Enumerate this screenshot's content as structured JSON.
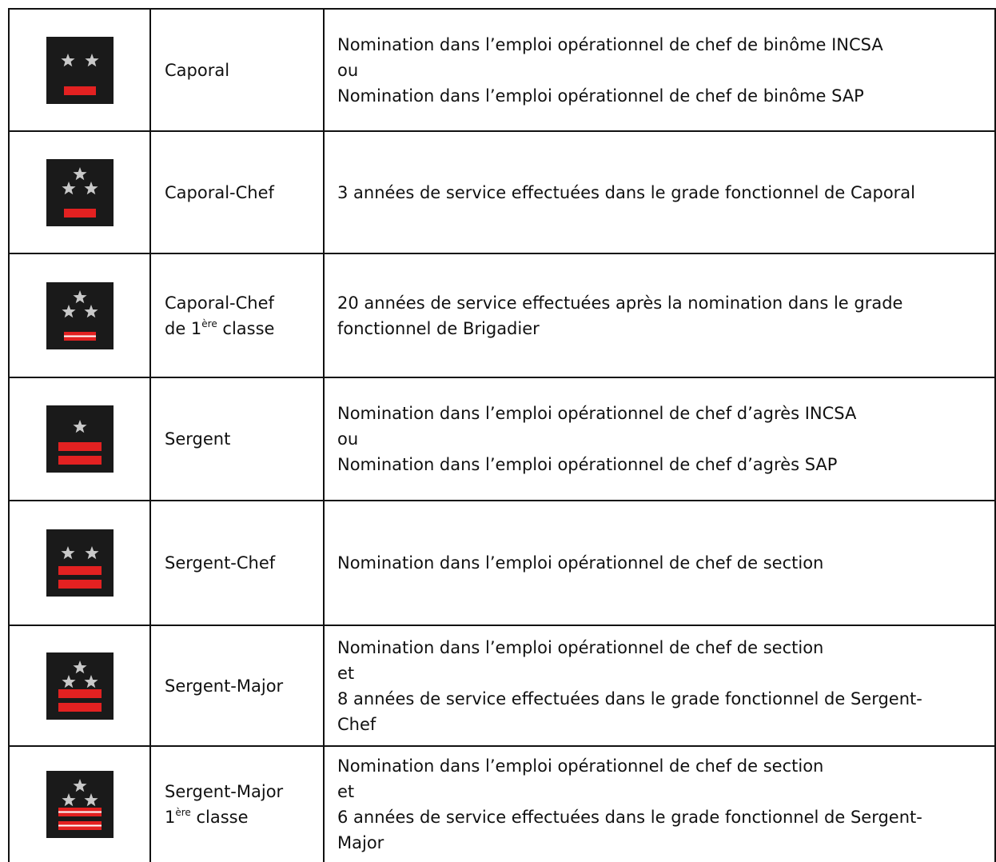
{
  "colors": {
    "insignia_bg": "#1a1a1a",
    "star": "#c9c9c9",
    "stripe": "#e32121",
    "stripe_line": "#ffffff",
    "border": "#111111"
  },
  "rows": [
    {
      "insignia": {
        "stars": 2,
        "stripes": 1,
        "white_line": false
      },
      "grade": {
        "line1": "Caporal",
        "line2_pre": "",
        "line2_sup": "",
        "line2_post": ""
      },
      "conditions": [
        "Nomination dans l’emploi opérationnel de chef de binôme INCSA",
        "ou",
        "Nomination dans l’emploi opérationnel de chef de binôme SAP"
      ]
    },
    {
      "insignia": {
        "stars": 3,
        "stripes": 1,
        "white_line": false
      },
      "grade": {
        "line1": "Caporal-Chef",
        "line2_pre": "",
        "line2_sup": "",
        "line2_post": ""
      },
      "conditions": [
        "3 années de service effectuées dans le grade fonctionnel de Caporal"
      ]
    },
    {
      "insignia": {
        "stars": 3,
        "stripes": 1,
        "white_line": true
      },
      "grade": {
        "line1": "Caporal-Chef",
        "line2_pre": "de 1",
        "line2_sup": "ère",
        "line2_post": " classe"
      },
      "conditions": [
        "20 années de service effectuées après la nomination dans le grade",
        "fonctionnel de Brigadier"
      ]
    },
    {
      "insignia": {
        "stars": 1,
        "stripes": 2,
        "white_line": false
      },
      "grade": {
        "line1": "Sergent",
        "line2_pre": "",
        "line2_sup": "",
        "line2_post": ""
      },
      "conditions": [
        "Nomination dans l’emploi opérationnel de chef d’agrès INCSA",
        "ou",
        "Nomination dans l’emploi opérationnel de chef d’agrès SAP"
      ]
    },
    {
      "insignia": {
        "stars": 2,
        "stripes": 2,
        "white_line": false
      },
      "grade": {
        "line1": "Sergent-Chef",
        "line2_pre": "",
        "line2_sup": "",
        "line2_post": ""
      },
      "conditions": [
        "Nomination dans l’emploi opérationnel de chef de section"
      ]
    },
    {
      "insignia": {
        "stars": 3,
        "stripes": 2,
        "white_line": false
      },
      "grade": {
        "line1": "Sergent-Major",
        "line2_pre": "",
        "line2_sup": "",
        "line2_post": ""
      },
      "conditions": [
        "Nomination dans l’emploi opérationnel de chef de section",
        "et",
        "8 années de service effectuées dans le grade fonctionnel de Sergent-",
        "Chef"
      ]
    },
    {
      "insignia": {
        "stars": 3,
        "stripes": 2,
        "white_line": true
      },
      "grade": {
        "line1": "Sergent-Major",
        "line2_pre": "1",
        "line2_sup": "ère",
        "line2_post": " classe"
      },
      "conditions": [
        "Nomination dans l’emploi opérationnel de chef de section",
        "et",
        "6 années de service effectuées dans le grade fonctionnel de Sergent-",
        "Major"
      ]
    }
  ]
}
